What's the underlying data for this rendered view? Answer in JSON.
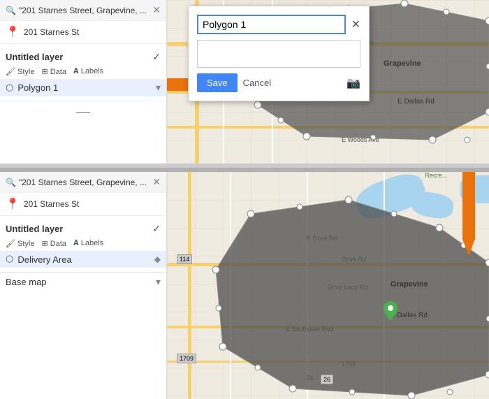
{
  "top": {
    "search": {
      "text": "\"201 Starnes Street, Grapevine, ...",
      "location": "201 Starnes St"
    },
    "layer": {
      "title": "Untitled layer",
      "tabs": [
        "Style",
        "Data",
        "Labels"
      ],
      "polygon": "Polygon 1"
    },
    "dialog": {
      "title": "Polygon 1",
      "save_label": "Save",
      "cancel_label": "Cancel"
    }
  },
  "bottom": {
    "search": {
      "text": "\"201 Starnes Street, Grapevine, ...",
      "location": "201 Starnes St"
    },
    "layer": {
      "title": "Untitled layer",
      "tabs": [
        "Style",
        "Data",
        "Labels"
      ],
      "polygon": "Delivery Area"
    },
    "basemap": "Base map"
  }
}
